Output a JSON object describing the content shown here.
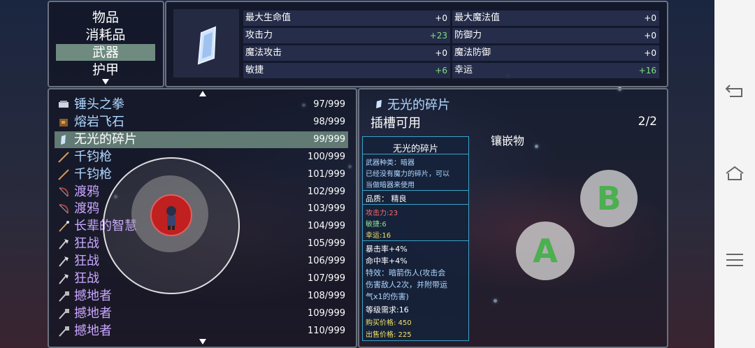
{
  "categories": {
    "items": [
      "物品",
      "消耗品",
      "武器",
      "护甲"
    ],
    "selected_index": 2
  },
  "stats": {
    "left": [
      {
        "label": "最大生命值",
        "value": "+0"
      },
      {
        "label": "攻击力",
        "value": "+23"
      },
      {
        "label": "魔法攻击",
        "value": "+0"
      },
      {
        "label": "敏捷",
        "value": "+6"
      }
    ],
    "right": [
      {
        "label": "最大魔法值",
        "value": "+0"
      },
      {
        "label": "防御力",
        "value": "+0"
      },
      {
        "label": "魔法防御",
        "value": "+0"
      },
      {
        "label": "幸运",
        "value": "+16"
      }
    ]
  },
  "inventory": [
    {
      "name": "锤头之拳",
      "count": "97/999",
      "icon": "fist-icon",
      "color": "blue"
    },
    {
      "name": "熔岩飞石",
      "count": "98/999",
      "icon": "lava-stone-icon",
      "color": "blue"
    },
    {
      "name": "无光的碎片",
      "count": "99/999",
      "icon": "shard-icon",
      "color": "white",
      "selected": true
    },
    {
      "name": "千钧枪",
      "count": "100/999",
      "icon": "spear-icon",
      "color": "blue"
    },
    {
      "name": "千钧枪",
      "count": "101/999",
      "icon": "spear-icon",
      "color": "blue"
    },
    {
      "name": "渡鸦",
      "count": "102/999",
      "icon": "bow-icon",
      "color": "purple"
    },
    {
      "name": "渡鸦",
      "count": "103/999",
      "icon": "bow-icon",
      "color": "purple"
    },
    {
      "name": "长辈的智慧",
      "count": "104/999",
      "icon": "staff-icon",
      "color": "purple"
    },
    {
      "name": "狂战",
      "count": "105/999",
      "icon": "axe-icon",
      "color": "purple"
    },
    {
      "name": "狂战",
      "count": "106/999",
      "icon": "axe-icon",
      "color": "purple"
    },
    {
      "name": "狂战",
      "count": "107/999",
      "icon": "axe-icon",
      "color": "purple"
    },
    {
      "name": "撼地者",
      "count": "108/999",
      "icon": "hammer-icon",
      "color": "purple"
    },
    {
      "name": "撼地者",
      "count": "109/999",
      "icon": "hammer-icon",
      "color": "purple"
    },
    {
      "name": "撼地者",
      "count": "110/999",
      "icon": "hammer-icon",
      "color": "purple"
    }
  ],
  "detail": {
    "title": "无光的碎片",
    "slot_text": "插槽可用",
    "slot_count": "2/2",
    "inlay_label": "镶嵌物"
  },
  "tooltip": {
    "title": "无光的碎片",
    "type_line": "武器种类：暗器",
    "desc_1": "已经没有魔力的碎片，可以",
    "desc_2": "当做暗器来使用",
    "quality": "品质：  精良",
    "attack": "攻击力:23",
    "agility": "敏捷:6",
    "luck": "幸运:16",
    "crit": "暴击率+4%",
    "hit": "命中率+4%",
    "effect_1": "特效：暗箭伤人(攻击会",
    "effect_2": "伤害敌人2次，并附带运",
    "effect_3": "气x1的伤害)",
    "level_req": "等级需求:16",
    "buy_price": "购买价格: 450",
    "sell_price": "出售价格: 225"
  },
  "buttons": {
    "a_label": "A",
    "b_label": "B"
  },
  "colors": {
    "panel_border": "#6b7280",
    "selected_row": "#6f8b80",
    "stat_green": "#7fe07f",
    "attack_red": "#ff6a6a",
    "agility_green": "#8fe08f",
    "luck_yellow": "#f1e36a",
    "price_yellow": "#f1e36a",
    "button_green": "#4caf50"
  }
}
